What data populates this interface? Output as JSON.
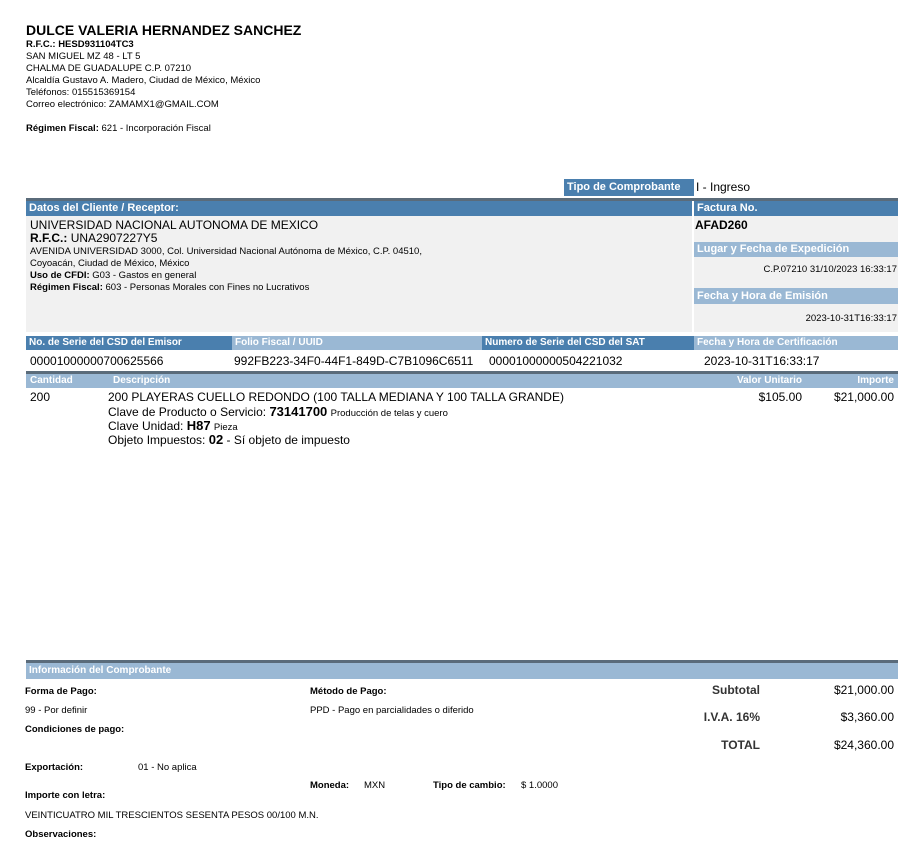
{
  "issuer": {
    "name": "DULCE VALERIA HERNANDEZ SANCHEZ",
    "rfc": "R.F.C.: HESD931104TC3",
    "address1": "SAN MIGUEL MZ 48 - LT 5",
    "address2": "CHALMA DE GUADALUPE C.P. 07210",
    "address3": "Alcaldía Gustavo A. Madero, Ciudad de México, México",
    "phone": "Teléfonos: 015515369154",
    "email": "Correo electrónico: ZAMAMX1@GMAIL.COM",
    "regimen_label": "Régimen Fiscal:",
    "regimen_value": "621 - Incorporación Fiscal"
  },
  "comprobante_type": {
    "label": "Tipo de Comprobante",
    "value": "I - Ingreso"
  },
  "client": {
    "header": "Datos del Cliente / Receptor:",
    "name": "UNIVERSIDAD NACIONAL AUTONOMA DE MEXICO",
    "rfc_label": "R.F.C.:",
    "rfc_value": "UNA2907227Y5",
    "address1": "AVENIDA UNIVERSIDAD 3000, Col. Universidad Nacional Autónoma de México, C.P. 04510,",
    "address2": "Coyoacán, Ciudad de México, México",
    "uso_label": "Uso de CFDI:",
    "uso_value": "G03 - Gastos en general",
    "regimen_label": "Régimen Fiscal:",
    "regimen_value": "603 - Personas Morales con Fines no Lucrativos"
  },
  "invoice": {
    "factura_label": "Factura No.",
    "factura_value": "AFAD260",
    "lugar_label": "Lugar y Fecha de Expedición",
    "lugar_value": "C.P.07210 31/10/2023 16:33:17",
    "emision_label": "Fecha y Hora de Emisión",
    "emision_value": "2023-10-31T16:33:17"
  },
  "csd": {
    "serie_emisor_label": "No. de Serie del CSD del Emisor",
    "serie_emisor_value": "00001000000700625566",
    "uuid_label": "Folio Fiscal / UUID",
    "uuid_value": "992FB223-34F0-44F1-849D-C7B1096C6511",
    "serie_sat_label": "Numero de Serie del CSD del SAT",
    "serie_sat_value": "00001000000504221032",
    "cert_label": "Fecha y Hora de Certificación",
    "cert_value": "2023-10-31T16:33:17"
  },
  "items_header": {
    "cantidad": "Cantidad",
    "descripcion": "Descripción",
    "valor": "Valor Unitario",
    "importe": "Importe"
  },
  "items": [
    {
      "cantidad": "200",
      "descripcion": "200 PLAYERAS CUELLO REDONDO (100 TALLA MEDIANA Y 100 TALLA GRANDE)",
      "clave_prod_label": "Clave de Producto o Servicio:",
      "clave_prod_code": "73141700",
      "clave_prod_desc": "Producción de telas y cuero",
      "clave_unidad_label": "Clave Unidad:",
      "clave_unidad_code": "H87",
      "clave_unidad_desc": "Pieza",
      "objeto_label": "Objeto Impuestos:",
      "objeto_code": "02",
      "objeto_desc": "- Sí objeto de impuesto",
      "valor": "$105.00",
      "importe": "$21,000.00"
    }
  ],
  "info": {
    "header": "Información del Comprobante",
    "forma_label": "Forma de Pago:",
    "forma_value": "99 - Por definir",
    "metodo_label": "Método de Pago:",
    "metodo_value": "PPD - Pago en parcialidades o diferido",
    "condiciones_label": "Condiciones de pago:",
    "exportacion_label": "Exportación:",
    "exportacion_value": "01 - No aplica",
    "moneda_label": "Moneda:",
    "moneda_value": "MXN",
    "tipo_cambio_label": "Tipo de cambio:",
    "tipo_cambio_value": "$ 1.0000",
    "importe_letra_label": "Importe con letra:",
    "importe_letra_value": "VEINTICUATRO MIL TRESCIENTOS SESENTA PESOS 00/100 M.N.",
    "observaciones_label": "Observaciones:"
  },
  "totals": {
    "subtotal_label": "Subtotal",
    "subtotal_value": "$21,000.00",
    "iva_label": "I.V.A. 16%",
    "iva_value": "$3,360.00",
    "total_label": "TOTAL",
    "total_value": "$24,360.00"
  }
}
